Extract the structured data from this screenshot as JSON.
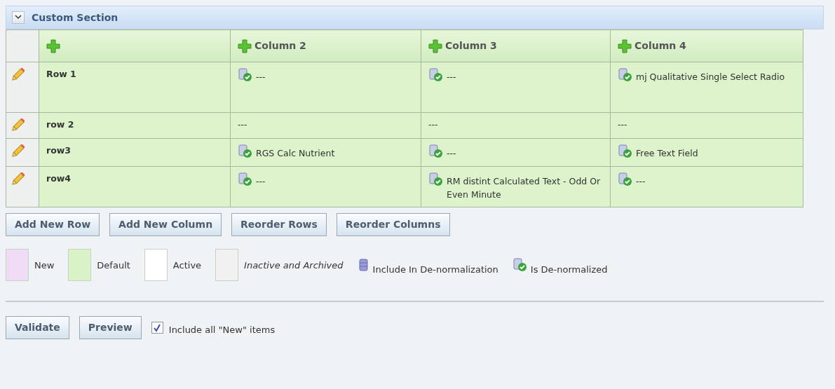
{
  "section": {
    "title": "Custom Section",
    "expanded": true
  },
  "table": {
    "columns": [
      {},
      {
        "label": "Column 2"
      },
      {
        "label": "Column 3"
      },
      {
        "label": "Column 4"
      }
    ],
    "rows": [
      {
        "cells": [
          {
            "text": "Row 1"
          },
          {
            "text": "---",
            "denormalized": true
          },
          {
            "text": "---",
            "denormalized": true
          },
          {
            "text": "mj Qualitative Single Select Radio",
            "denormalized": true
          }
        ]
      },
      {
        "cells": [
          {
            "text": "row 2"
          },
          {
            "text": "---",
            "denormalized": false
          },
          {
            "text": "---",
            "denormalized": false
          },
          {
            "text": "---",
            "denormalized": false
          }
        ]
      },
      {
        "cells": [
          {
            "text": "row3"
          },
          {
            "text": "RGS Calc Nutrient",
            "denormalized": true
          },
          {
            "text": "---",
            "denormalized": true
          },
          {
            "text": "Free Text Field",
            "denormalized": true
          }
        ]
      },
      {
        "cells": [
          {
            "text": "row4"
          },
          {
            "text": "---",
            "denormalized": true
          },
          {
            "text": "RM distint Calculated Text - Odd Or Even Minute",
            "denormalized": true
          },
          {
            "text": "---",
            "denormalized": true
          }
        ]
      }
    ]
  },
  "table_buttons": [
    "Add New Row",
    "Add New Column",
    "Reorder Rows",
    "Reorder Columns"
  ],
  "legend": [
    {
      "kind": "swatch",
      "label": "New",
      "color": "#f0dcf5",
      "italic": false
    },
    {
      "kind": "swatch",
      "label": "Default",
      "color": "#d9f2c6",
      "italic": false
    },
    {
      "kind": "swatch",
      "label": "Active",
      "color": "#ffffff",
      "italic": false
    },
    {
      "kind": "swatch",
      "label": "Inactive and Archived",
      "color": "#f1f1f1",
      "italic": true
    },
    {
      "kind": "include-icon",
      "label": "Include In De-normalization"
    },
    {
      "kind": "denormalized-icon",
      "label": "Is De-normalized"
    }
  ],
  "footer_buttons": [
    "Validate",
    "Preview"
  ],
  "include_new": {
    "label": "Include all \"New\" items",
    "checked": true
  }
}
